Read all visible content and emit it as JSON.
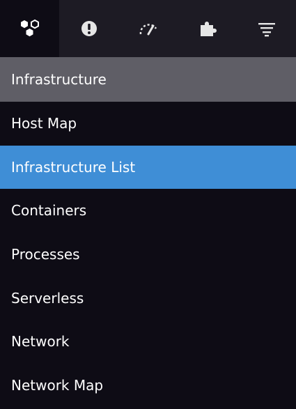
{
  "icon_bar": {
    "tabs": [
      {
        "icon": "infrastructure-hexagons-icon",
        "active": true
      },
      {
        "icon": "alert-circle-icon",
        "active": false
      },
      {
        "icon": "speedometer-icon",
        "active": false
      },
      {
        "icon": "puzzle-piece-icon",
        "active": false
      },
      {
        "icon": "filter-lines-icon",
        "active": false
      }
    ]
  },
  "section": {
    "title": "Infrastructure"
  },
  "nav": {
    "items": [
      {
        "label": "Host Map",
        "active": false
      },
      {
        "label": "Infrastructure List",
        "active": true
      },
      {
        "label": "Containers",
        "active": false
      },
      {
        "label": "Processes",
        "active": false
      },
      {
        "label": "Serverless",
        "active": false
      },
      {
        "label": "Network",
        "active": false
      },
      {
        "label": "Network Map",
        "active": false
      }
    ]
  },
  "colors": {
    "menu_background": "#0e0c15",
    "icon_bar_background": "#1d1b24",
    "section_header_background": "#5f5e66",
    "active_item_background": "#3f8ed6",
    "text": "#ffffff",
    "icon": "#e6e6e6"
  }
}
